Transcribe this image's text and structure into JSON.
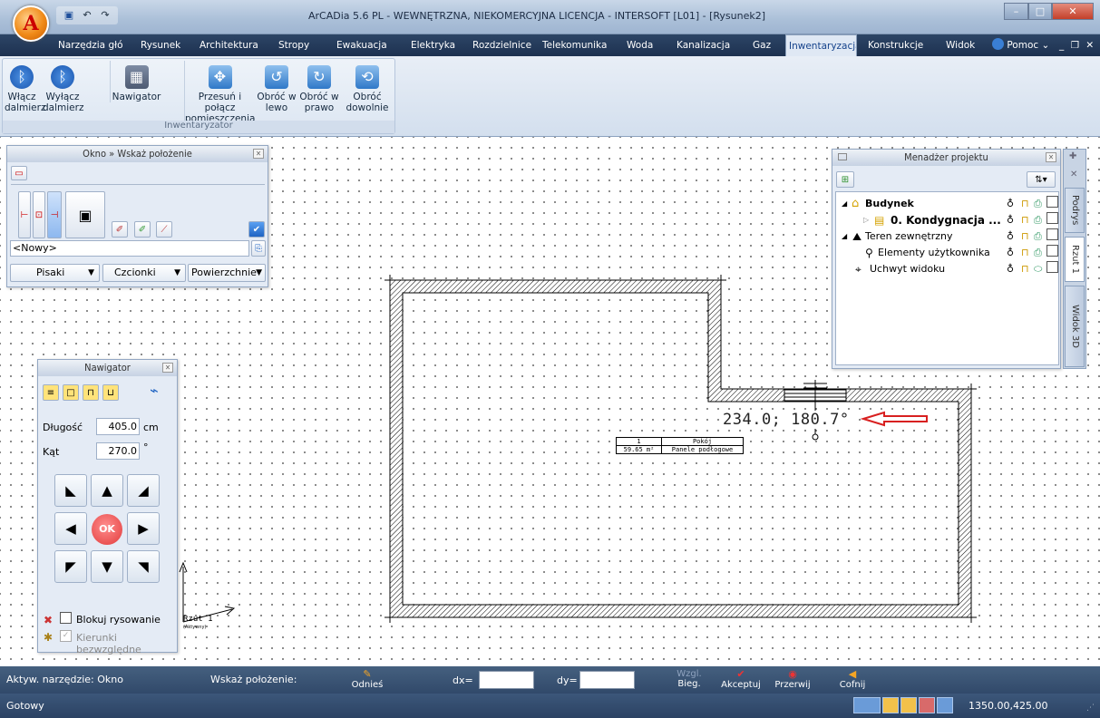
{
  "window": {
    "title": "ArCADia 5.6 PL - WEWNĘTRZNA, NIEKOMERCYJNA LICENCJA - INTERSOFT [L01] - [Rysunek2]",
    "app_letter": "A",
    "min": "–",
    "max": "□",
    "close": "✕"
  },
  "qat": {
    "save": "▣",
    "undo": "↶",
    "redo": "↷"
  },
  "tabs": [
    "Narzędzia głó",
    "Rysunek",
    "Architektura",
    "Stropy",
    "Ewakuacja",
    "Elektryka",
    "Rozdzielnice",
    "Telekomunika",
    "Woda",
    "Kanalizacja",
    "Gaz",
    "Inwentaryzacja",
    "Konstrukcje",
    "Widok"
  ],
  "help": {
    "label": "Pomoc",
    "chev": "⌄",
    "icons": "_ ❐ ✕"
  },
  "ribbon": {
    "group_label": "Inwentaryzator",
    "buttons": [
      {
        "line1": "Włącz",
        "line2": "dalmierz"
      },
      {
        "line1": "Wyłącz",
        "line2": "dalmierz"
      },
      {
        "line1": "Nawigator",
        "line2": ""
      },
      {
        "line1": "Przesuń i połącz",
        "line2": "pomieszczenia"
      },
      {
        "line1": "Obróć w",
        "line2": "lewo"
      },
      {
        "line1": "Obróć w",
        "line2": "prawo"
      },
      {
        "line1": "Obróć",
        "line2": "dowolnie"
      }
    ]
  },
  "okno_panel": {
    "title": "Okno » Wskaż położenie",
    "new_value": "<Nowy>",
    "pisaki": "Pisaki",
    "czcionki": "Czcionki",
    "powierzchnie": "Powierzchnie"
  },
  "nawigator": {
    "title": "Nawigator",
    "dlugosc_label": "Długość",
    "dlugosc_value": "405.0",
    "dlugosc_unit": "cm",
    "kat_label": "Kąt",
    "kat_value": "270.0",
    "kat_unit": "°",
    "ok": "OK",
    "blokuj": "Blokuj rysowanie",
    "kierunki": "Kierunki bezwzględne"
  },
  "drawing": {
    "dimension_text": "234.0; 180.7°",
    "room_number": "1",
    "room_name": "Pokój",
    "room_area": "59.65 m²",
    "room_floor": "Panele podłogowe",
    "axis_label": "Rzut 1",
    "axis_sublabel": "(Aktywny)"
  },
  "project_manager": {
    "title": "Menadżer projektu",
    "items": [
      {
        "label": "Budynek",
        "bold": true
      },
      {
        "label": "0. Kondygnacja ...",
        "bold": true
      },
      {
        "label": "Teren zewnętrzny",
        "bold": false
      },
      {
        "label": "Elementy użytkownika",
        "bold": false
      },
      {
        "label": "Uchwyt widoku",
        "bold": false
      }
    ]
  },
  "side_tabs": [
    "Podrys",
    "Rzut 1",
    "Widok 3D"
  ],
  "cmdbar": {
    "active_tool": "Aktyw. narzędzie: Okno",
    "prompt": "Wskaż położenie:",
    "odnies": "Odnieś",
    "dx": "dx=",
    "dy": "dy=",
    "wzgl": "Wzgl.",
    "bieg": "Bieg.",
    "akceptuj": "Akceptuj",
    "przerwij": "Przerwij",
    "cofnij": "Cofnij"
  },
  "status": {
    "ready": "Gotowy",
    "coords": "1350.00,425.00"
  },
  "colors": {
    "accent": "#15428b",
    "tabbar": "#1d3150",
    "arrow_red": "#d82020"
  }
}
